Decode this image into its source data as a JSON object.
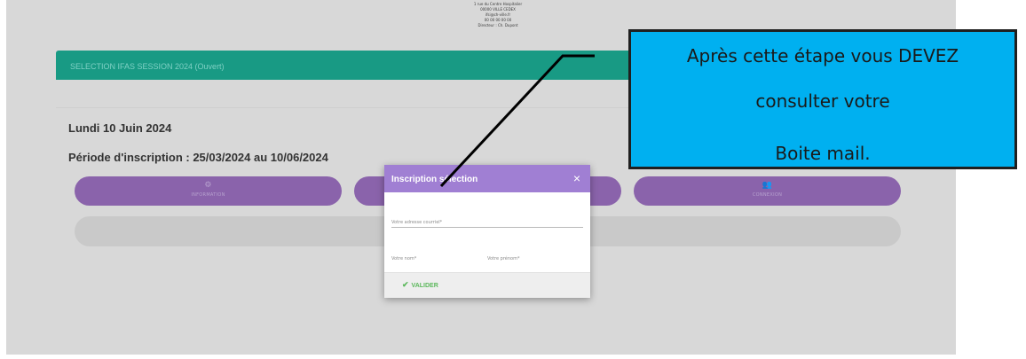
{
  "address": {
    "lines": [
      "1 rue du Centre Hospitalier",
      "00000 VILLE CEDEX",
      "ifsi@ch-ville.fr",
      "00 00 00 00 00",
      "Directeur : Ch. Dupont"
    ]
  },
  "panel": {
    "header": "SELECTION IFAS SESSION 2024 (Ouvert)"
  },
  "session": {
    "date": "Lundi 10 Juin 2024",
    "period": "Période d'inscription : 25/03/2024 au 10/06/2024"
  },
  "pills": [
    {
      "icon": "⚙",
      "label": "INFORMATION"
    },
    {
      "icon": "",
      "label": ""
    },
    {
      "icon": "👥",
      "label": "CONNEXION"
    }
  ],
  "modal": {
    "title": "Inscription sélection",
    "close": "×",
    "email_label": "Votre adresse courriel*",
    "nom_label": "Votre nom*",
    "prenom_label": "Votre prénom*",
    "submit": "VALIDER",
    "submit_icon": "✔"
  },
  "callout": {
    "line1": "Après cette étape vous DEVEZ",
    "line2": "consulter votre",
    "line3": "Boite mail."
  },
  "colors": {
    "header_green": "#189a84",
    "pill_purple": "#8a63ab",
    "modal_purple": "#a07fd3",
    "callout_blue": "#00b0f0",
    "validate_green": "#5cb85c"
  }
}
